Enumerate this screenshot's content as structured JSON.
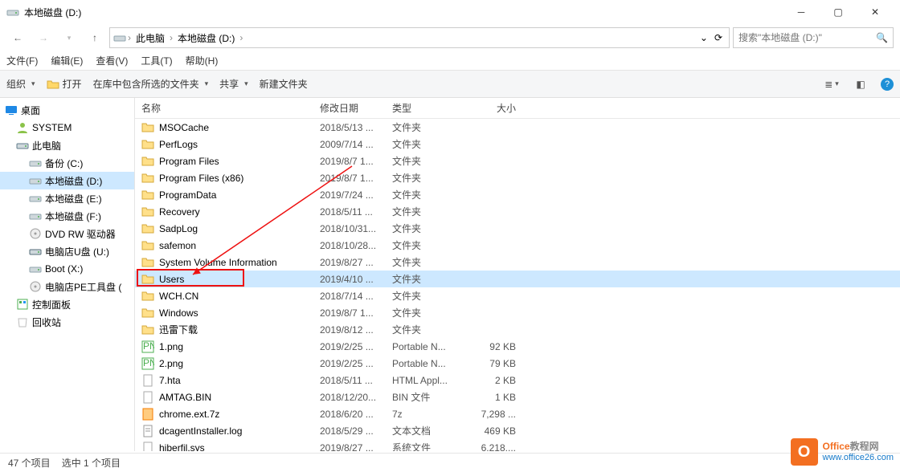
{
  "window": {
    "title": "本地磁盘 (D:)"
  },
  "nav": {
    "back": "←",
    "forward": "→",
    "up": "↑"
  },
  "breadcrumb": {
    "root": "此电脑",
    "current": "本地磁盘 (D:)"
  },
  "search": {
    "placeholder": "搜索\"本地磁盘 (D:)\""
  },
  "menu": {
    "file": "文件(F)",
    "edit": "编辑(E)",
    "view": "查看(V)",
    "tools": "工具(T)",
    "help": "帮助(H)"
  },
  "toolbar": {
    "organize": "组织",
    "open": "打开",
    "include": "在库中包含所选的文件夹",
    "share": "共享",
    "new_folder": "新建文件夹"
  },
  "tree": [
    {
      "label": "桌面",
      "level": 0,
      "icon": "desktop"
    },
    {
      "label": "SYSTEM",
      "level": 1,
      "icon": "user"
    },
    {
      "label": "此电脑",
      "level": 1,
      "icon": "pc"
    },
    {
      "label": "备份 (C:)",
      "level": 2,
      "icon": "hdd"
    },
    {
      "label": "本地磁盘 (D:)",
      "level": 2,
      "icon": "hdd",
      "selected": true
    },
    {
      "label": "本地磁盘 (E:)",
      "level": 2,
      "icon": "hdd"
    },
    {
      "label": "本地磁盘 (F:)",
      "level": 2,
      "icon": "hdd"
    },
    {
      "label": "DVD RW 驱动器",
      "level": 2,
      "icon": "dvd"
    },
    {
      "label": "电脑店U盘 (U:)",
      "level": 2,
      "icon": "usb"
    },
    {
      "label": "Boot (X:)",
      "level": 2,
      "icon": "hdd"
    },
    {
      "label": "电脑店PE工具盘 (",
      "level": 2,
      "icon": "dvd"
    },
    {
      "label": "控制面板",
      "level": 1,
      "icon": "cpl"
    },
    {
      "label": "回收站",
      "level": 1,
      "icon": "bin"
    }
  ],
  "columns": {
    "name": "名称",
    "date": "修改日期",
    "type": "类型",
    "size": "大小"
  },
  "files": [
    {
      "name": "MSOCache",
      "date": "2018/5/13 ...",
      "type": "文件夹",
      "size": "",
      "icon": "folder"
    },
    {
      "name": "PerfLogs",
      "date": "2009/7/14 ...",
      "type": "文件夹",
      "size": "",
      "icon": "folder"
    },
    {
      "name": "Program Files",
      "date": "2019/8/7 1...",
      "type": "文件夹",
      "size": "",
      "icon": "folder"
    },
    {
      "name": "Program Files (x86)",
      "date": "2019/8/7 1...",
      "type": "文件夹",
      "size": "",
      "icon": "folder"
    },
    {
      "name": "ProgramData",
      "date": "2019/7/24 ...",
      "type": "文件夹",
      "size": "",
      "icon": "folder"
    },
    {
      "name": "Recovery",
      "date": "2018/5/11 ...",
      "type": "文件夹",
      "size": "",
      "icon": "folder"
    },
    {
      "name": "SadpLog",
      "date": "2018/10/31...",
      "type": "文件夹",
      "size": "",
      "icon": "folder"
    },
    {
      "name": "safemon",
      "date": "2018/10/28...",
      "type": "文件夹",
      "size": "",
      "icon": "folder"
    },
    {
      "name": "System Volume Information",
      "date": "2019/8/27 ...",
      "type": "文件夹",
      "size": "",
      "icon": "folder"
    },
    {
      "name": "Users",
      "date": "2019/4/10 ...",
      "type": "文件夹",
      "size": "",
      "icon": "folder",
      "selected": true
    },
    {
      "name": "WCH.CN",
      "date": "2018/7/14 ...",
      "type": "文件夹",
      "size": "",
      "icon": "folder"
    },
    {
      "name": "Windows",
      "date": "2019/8/7 1...",
      "type": "文件夹",
      "size": "",
      "icon": "folder"
    },
    {
      "name": "迅雷下载",
      "date": "2019/8/12 ...",
      "type": "文件夹",
      "size": "",
      "icon": "folder"
    },
    {
      "name": "1.png",
      "date": "2019/2/25 ...",
      "type": "Portable N...",
      "size": "92 KB",
      "icon": "png"
    },
    {
      "name": "2.png",
      "date": "2019/2/25 ...",
      "type": "Portable N...",
      "size": "79 KB",
      "icon": "png"
    },
    {
      "name": "7.hta",
      "date": "2018/5/11 ...",
      "type": "HTML Appl...",
      "size": "2 KB",
      "icon": "hta"
    },
    {
      "name": "AMTAG.BIN",
      "date": "2018/12/20...",
      "type": "BIN 文件",
      "size": "1 KB",
      "icon": "bin"
    },
    {
      "name": "chrome.ext.7z",
      "date": "2018/6/20 ...",
      "type": "7z",
      "size": "7,298 ...",
      "icon": "7z"
    },
    {
      "name": "dcagentInstaller.log",
      "date": "2018/5/29 ...",
      "type": "文本文档",
      "size": "469 KB",
      "icon": "txt"
    },
    {
      "name": "hiberfil.sys",
      "date": "2019/8/27 ...",
      "type": "系统文件",
      "size": "6,218,...",
      "icon": "sys"
    }
  ],
  "status": {
    "items": "47 个项目",
    "selected": "选中 1 个项目"
  },
  "watermark": {
    "brand1": "Office",
    "brand2": "教程网",
    "url": "www.office26.com"
  }
}
